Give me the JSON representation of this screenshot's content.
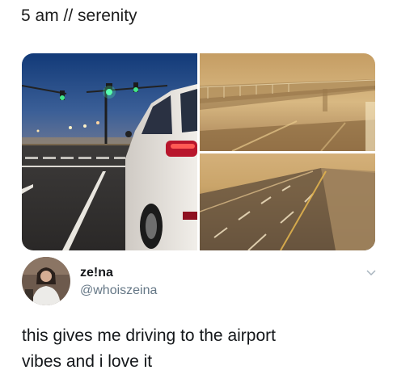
{
  "caption": "5 am // serenity",
  "media": {
    "images": [
      {
        "name": "night-intersection-suv-photo"
      },
      {
        "name": "foggy-bridge-photo"
      },
      {
        "name": "foggy-highway-photo"
      }
    ]
  },
  "tweet": {
    "display_name": "ze!na",
    "handle": "@whoiszeina",
    "text_line_1": "this gives me driving to the airport",
    "text_line_2": "vibes and i love it",
    "menu_icon": "chevron-down-icon"
  },
  "colors": {
    "text": "#14171a",
    "muted": "#657786",
    "fog": "#d3b079"
  }
}
